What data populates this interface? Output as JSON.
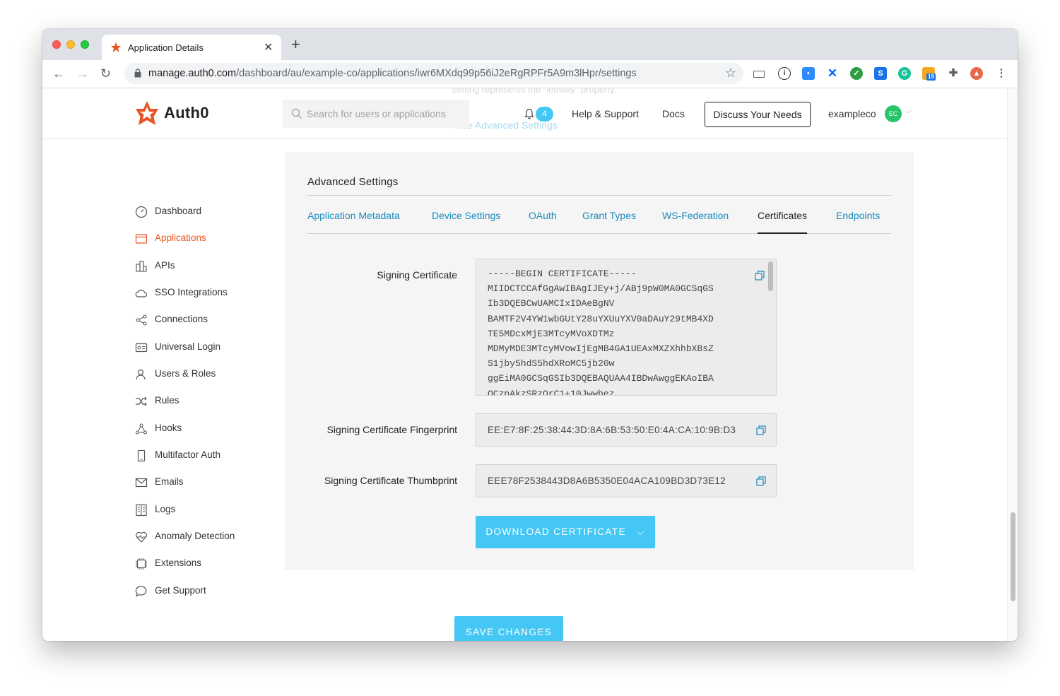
{
  "browser": {
    "tab_title": "Application Details",
    "tab_close": "✕",
    "new_tab": "+",
    "url_host": "manage.auth0.com",
    "url_path": "/dashboard/au/example-co/applications/iwr6MXdq99p56iJ2eRgRPFr5A9m3lHpr/settings",
    "ext_badge": "19"
  },
  "ghost": {
    "line1": "setting represents the \"leeway\" property.",
    "line2": "Hide Advanced Settings"
  },
  "header": {
    "logo_text": "Auth0",
    "search_placeholder": "Search for users or applications",
    "notification_count": "4",
    "help_label": "Help & Support",
    "docs_label": "Docs",
    "discuss_label": "Discuss Your Needs",
    "tenant_name": "exampleco",
    "avatar_initials": "EC",
    "accent_color": "#44c7f4"
  },
  "sidebar": {
    "items": [
      {
        "label": "Dashboard",
        "icon": "dashboard-icon"
      },
      {
        "label": "Applications",
        "icon": "applications-icon",
        "active": true
      },
      {
        "label": "APIs",
        "icon": "apis-icon"
      },
      {
        "label": "SSO Integrations",
        "icon": "cloud-icon"
      },
      {
        "label": "Connections",
        "icon": "connections-icon"
      },
      {
        "label": "Universal Login",
        "icon": "universal-login-icon"
      },
      {
        "label": "Users & Roles",
        "icon": "users-icon"
      },
      {
        "label": "Rules",
        "icon": "rules-icon"
      },
      {
        "label": "Hooks",
        "icon": "hooks-icon"
      },
      {
        "label": "Multifactor Auth",
        "icon": "phone-icon"
      },
      {
        "label": "Emails",
        "icon": "envelope-icon"
      },
      {
        "label": "Logs",
        "icon": "logs-icon"
      },
      {
        "label": "Anomaly Detection",
        "icon": "heart-icon"
      },
      {
        "label": "Extensions",
        "icon": "chip-icon"
      },
      {
        "label": "Get Support",
        "icon": "chat-bubble-icon"
      }
    ]
  },
  "panel": {
    "title": "Advanced Settings",
    "tabs": [
      "Application Metadata",
      "Device Settings",
      "OAuth",
      "Grant Types",
      "WS-Federation",
      "Certificates",
      "Endpoints"
    ],
    "active_tab": "Certificates",
    "signing_cert_label": "Signing Certificate",
    "signing_cert_value": "-----BEGIN CERTIFICATE-----\nMIIDCTCCAfGgAwIBAgIJEy+j/ABj9pW0MA0GCSqGS\nIb3DQEBCwUAMCIxIDAeBgNV\nBAMTF2V4YW1wbGUtY28uYXUuYXV0aDAuY29tMB4XD\nTE5MDcxMjE3MTcyMVoXDTMz\nMDMyMDE3MTcyMVowIjEgMB4GA1UEAxMXZXhhbXBsZ\nS1jby5hdS5hdXRoMC5jb20w\nggEiMA0GCSqGSIb3DQEBAQUAA4IBDwAwggEKAoIBA\nQCzpAkzSRzOrC1+10Jwwbez",
    "fingerprint_label": "Signing Certificate Fingerprint",
    "fingerprint_value": "EE:E7:8F:25:38:44:3D:8A:6B:53:50:E0:4A:CA:10:9B:D3",
    "thumbprint_label": "Signing Certificate Thumbprint",
    "thumbprint_value": "EEE78F2538443D8A6B5350E04ACA109BD3D73E12",
    "download_label": "DOWNLOAD CERTIFICATE",
    "download_caret": "⌵"
  },
  "save_label": "SAVE CHANGES"
}
